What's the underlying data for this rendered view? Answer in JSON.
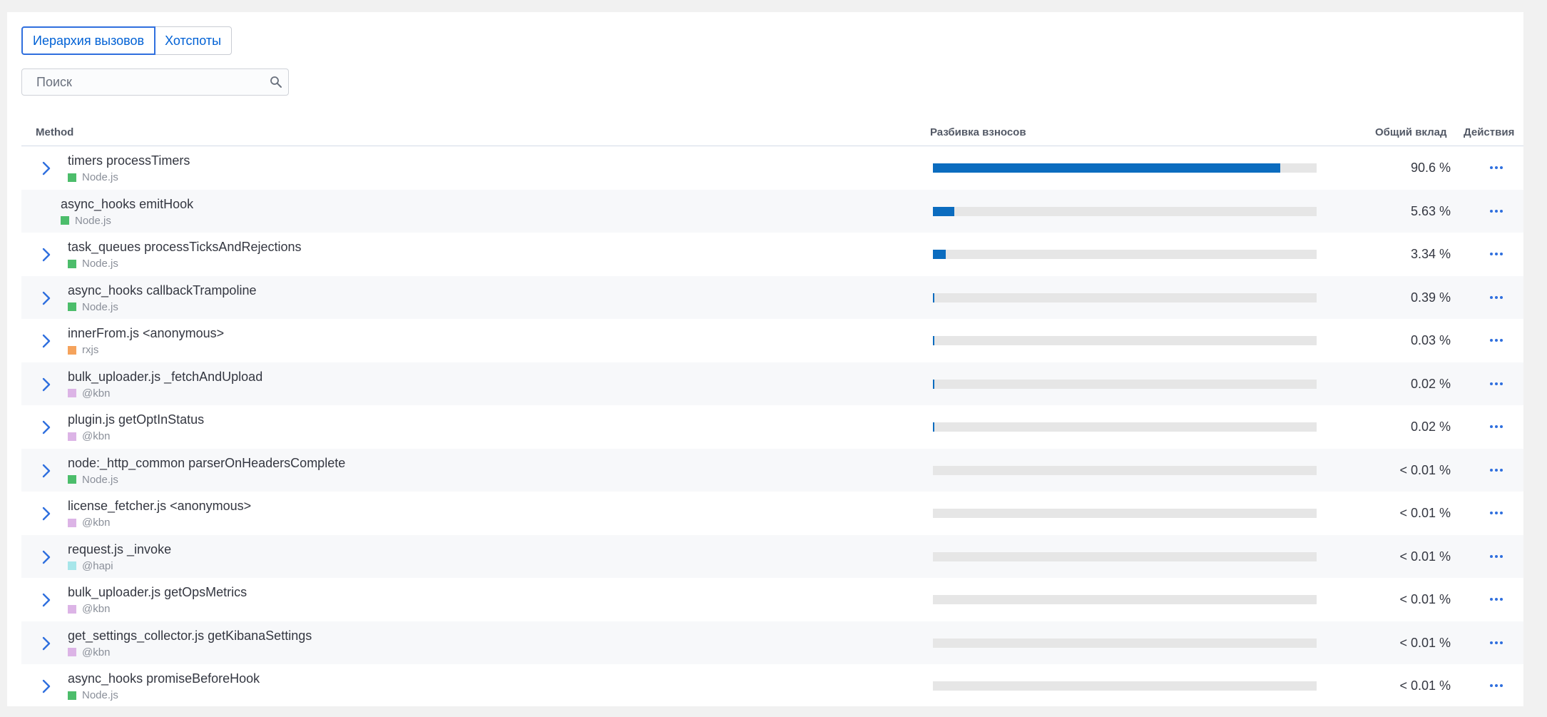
{
  "tabs": [
    "Иерархия вызовов",
    "Хотспоты"
  ],
  "search": {
    "placeholder": "Поиск",
    "value": ""
  },
  "columns": {
    "method": "Method",
    "breakdown": "Разбивка взносов",
    "total": "Общий вклад",
    "actions": "Действия"
  },
  "colors": {
    "accent": "#0061d5",
    "bar": "#0b6cbf",
    "track": "#e6e6e6",
    "Node.js": "#54b399",
    "rxjs": "#f5a35c",
    "@kbn": "#d6bf57",
    "@hapi": "#9edfe4"
  },
  "rows": [
    {
      "title": "timers processTimers",
      "lib": "Node.js",
      "swatch": "#4cbd6b",
      "pct": "90.6 %",
      "fraction": 0.906,
      "expandable": true
    },
    {
      "title": "async_hooks emitHook",
      "lib": "Node.js",
      "swatch": "#4cbd6b",
      "pct": "5.63 %",
      "fraction": 0.0563,
      "expandable": false
    },
    {
      "title": "task_queues processTicksAndRejections",
      "lib": "Node.js",
      "swatch": "#4cbd6b",
      "pct": "3.34 %",
      "fraction": 0.0334,
      "expandable": true
    },
    {
      "title": "async_hooks callbackTrampoline",
      "lib": "Node.js",
      "swatch": "#4cbd6b",
      "pct": "0.39 %",
      "fraction": 0.0039,
      "expandable": true
    },
    {
      "title": "innerFrom.js <anonymous>",
      "lib": "rxjs",
      "swatch": "#f5a35c",
      "pct": "0.03 %",
      "fraction": 0.0003,
      "expandable": true
    },
    {
      "title": "bulk_uploader.js _fetchAndUpload",
      "lib": "@kbn",
      "swatch": "#dcb4e6",
      "pct": "0.02 %",
      "fraction": 0.0002,
      "expandable": true
    },
    {
      "title": "plugin.js getOptInStatus",
      "lib": "@kbn",
      "swatch": "#dcb4e6",
      "pct": "0.02 %",
      "fraction": 0.0002,
      "expandable": true
    },
    {
      "title": "node:_http_common parserOnHeadersComplete",
      "lib": "Node.js",
      "swatch": "#4cbd6b",
      "pct": "< 0.01 %",
      "fraction": 0,
      "expandable": true
    },
    {
      "title": "license_fetcher.js <anonymous>",
      "lib": "@kbn",
      "swatch": "#dcb4e6",
      "pct": "< 0.01 %",
      "fraction": 0,
      "expandable": true
    },
    {
      "title": "request.js _invoke",
      "lib": "@hapi",
      "swatch": "#a7e6ea",
      "pct": "< 0.01 %",
      "fraction": 0,
      "expandable": true
    },
    {
      "title": "bulk_uploader.js getOpsMetrics",
      "lib": "@kbn",
      "swatch": "#dcb4e6",
      "pct": "< 0.01 %",
      "fraction": 0,
      "expandable": true
    },
    {
      "title": "get_settings_collector.js getKibanaSettings",
      "lib": "@kbn",
      "swatch": "#dcb4e6",
      "pct": "< 0.01 %",
      "fraction": 0,
      "expandable": true
    },
    {
      "title": "async_hooks promiseBeforeHook",
      "lib": "Node.js",
      "swatch": "#4cbd6b",
      "pct": "< 0.01 %",
      "fraction": 0,
      "expandable": true
    }
  ],
  "icons": {
    "search": "search-icon",
    "expand": "chevron-right-icon",
    "actions": "ellipsis-icon"
  }
}
